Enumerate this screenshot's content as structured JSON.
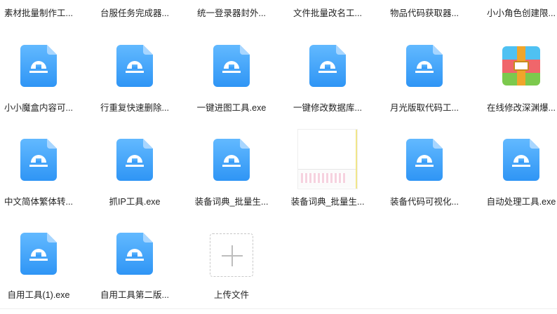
{
  "row0": [
    {
      "label": "素材批量制作工..."
    },
    {
      "label": "台服任务完成器..."
    },
    {
      "label": "统一登录器封外..."
    },
    {
      "label": "文件批量改名工..."
    },
    {
      "label": "物品代码获取器..."
    },
    {
      "label": "小小角色创建限..."
    }
  ],
  "row1": [
    {
      "label": "小小魔盒内容可...",
      "icon": "exe-file-icon"
    },
    {
      "label": "行重复快速删除...",
      "icon": "exe-file-icon"
    },
    {
      "label": "一键进图工具.exe",
      "icon": "exe-file-icon"
    },
    {
      "label": "一键修改数据库...",
      "icon": "exe-file-icon"
    },
    {
      "label": "月光版取代码工...",
      "icon": "exe-file-icon"
    },
    {
      "label": "在线修改深渊爆...",
      "icon": "archive-icon"
    }
  ],
  "row2": [
    {
      "label": "中文简体繁体转...",
      "icon": "exe-file-icon"
    },
    {
      "label": "抓IP工具.exe",
      "icon": "exe-file-icon"
    },
    {
      "label": "装备词典_批量生...",
      "icon": "exe-file-icon"
    },
    {
      "label": "装备词典_批量生...",
      "icon": "image-thumbnail"
    },
    {
      "label": "装备代码可视化...",
      "icon": "exe-file-icon"
    },
    {
      "label": "自动处理工具.exe",
      "icon": "exe-file-icon"
    }
  ],
  "row3": [
    {
      "label": "自用工具(1).exe",
      "icon": "exe-file-icon"
    },
    {
      "label": "自用工具第二版...",
      "icon": "exe-file-icon"
    }
  ],
  "upload": {
    "label": "上传文件",
    "icon": "plus-icon"
  },
  "colors": {
    "file_icon_top": "#62b9ff",
    "file_icon_bottom": "#2f95f5",
    "text": "#222222"
  }
}
